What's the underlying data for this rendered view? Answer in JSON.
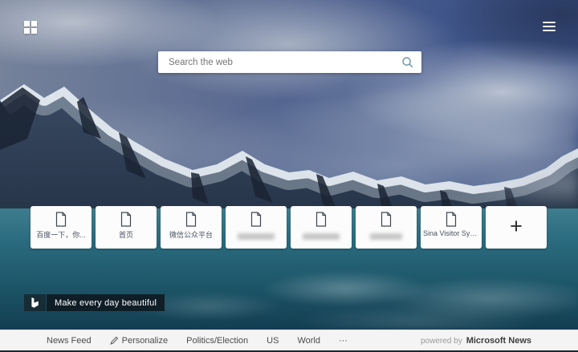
{
  "search": {
    "placeholder": "Search the web"
  },
  "tiles": [
    {
      "label": "百度一下，你..."
    },
    {
      "label": "首页"
    },
    {
      "label": "微信公众平台"
    },
    {
      "label": "",
      "redacted": true
    },
    {
      "label": "",
      "redacted": true
    },
    {
      "label": "",
      "redacted": true
    },
    {
      "label": "Sina Visitor Sys..."
    },
    {
      "label": "+"
    }
  ],
  "bing": {
    "tagline": "Make every day beautiful"
  },
  "footer": {
    "items": [
      "News Feed",
      "Personalize",
      "Politics/Election",
      "US",
      "World",
      "···"
    ],
    "powered_by": "powered by",
    "brand": "Microsoft News"
  },
  "colors": {
    "water": "#1d5669",
    "footer_bg": "#f4f4f4",
    "search_icon": "#6b93a8",
    "badge_bg": "#10181e"
  }
}
